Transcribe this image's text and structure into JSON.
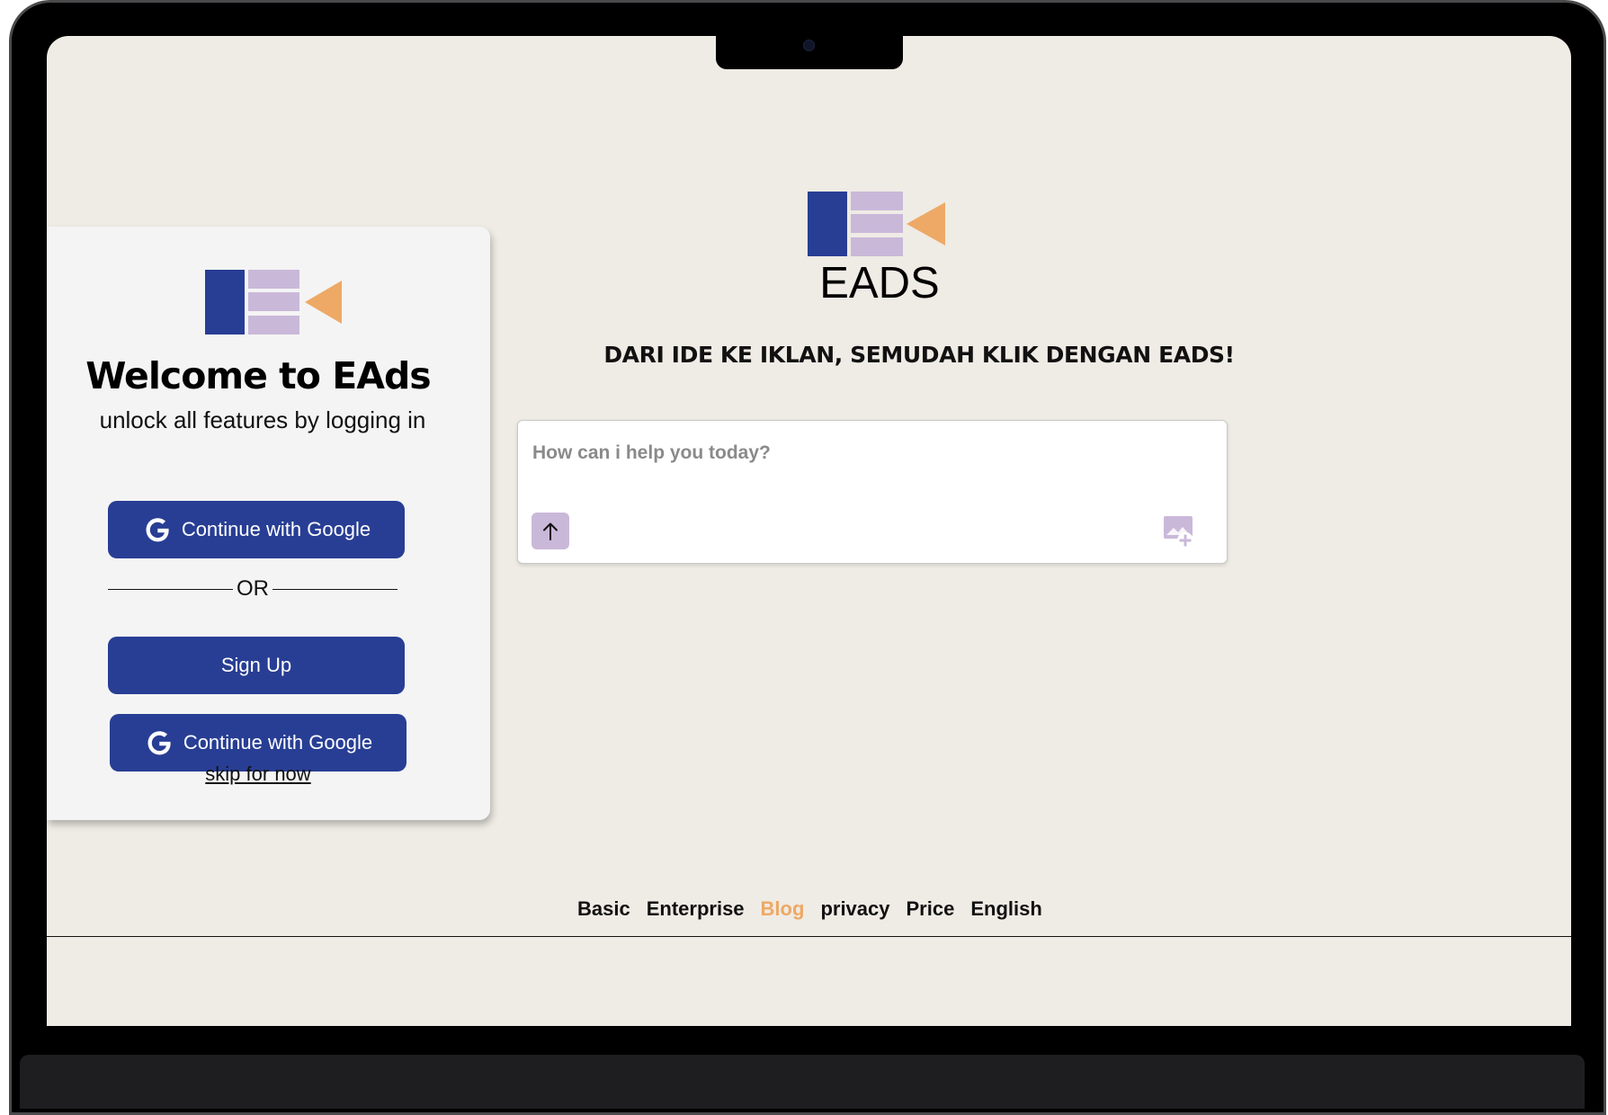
{
  "login": {
    "title": "Welcome to EAds",
    "subtitle": "unlock all features by logging in",
    "google_label": "Continue with Google",
    "or_label": "OR",
    "signup_label": "Sign Up",
    "google_label_2": "Continue with Google",
    "skip_label": "skip for now"
  },
  "brand": {
    "name": "EADS",
    "tagline": "DARI IDE KE IKLAN, SEMUDAH KLIK DENGAN EADS!",
    "colors": {
      "navy": "#283e94",
      "lavender": "#cab8d9",
      "orange": "#eda965"
    }
  },
  "prompt": {
    "placeholder": "How can i help you today?",
    "send_icon": "arrow-up-icon",
    "image_icon": "add-image-icon"
  },
  "footer": {
    "links": [
      "Basic",
      "Enterprise",
      "Blog",
      "privacy",
      "Price",
      "English"
    ],
    "active_link": "Blog"
  }
}
